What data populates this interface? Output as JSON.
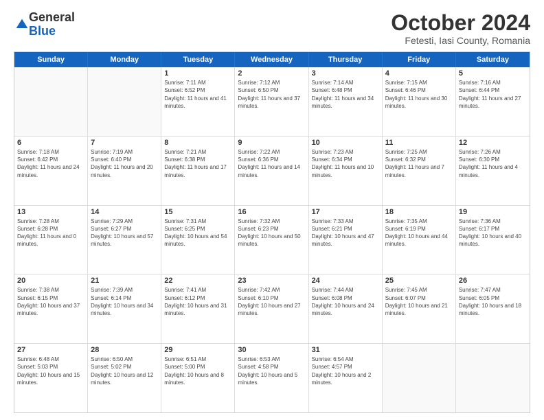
{
  "logo": {
    "general": "General",
    "blue": "Blue"
  },
  "header": {
    "month": "October 2024",
    "location": "Fetesti, Iasi County, Romania"
  },
  "weekdays": [
    "Sunday",
    "Monday",
    "Tuesday",
    "Wednesday",
    "Thursday",
    "Friday",
    "Saturday"
  ],
  "weeks": [
    [
      {
        "day": "",
        "empty": true
      },
      {
        "day": "",
        "empty": true
      },
      {
        "day": "1",
        "sunrise": "Sunrise: 7:11 AM",
        "sunset": "Sunset: 6:52 PM",
        "daylight": "Daylight: 11 hours and 41 minutes."
      },
      {
        "day": "2",
        "sunrise": "Sunrise: 7:12 AM",
        "sunset": "Sunset: 6:50 PM",
        "daylight": "Daylight: 11 hours and 37 minutes."
      },
      {
        "day": "3",
        "sunrise": "Sunrise: 7:14 AM",
        "sunset": "Sunset: 6:48 PM",
        "daylight": "Daylight: 11 hours and 34 minutes."
      },
      {
        "day": "4",
        "sunrise": "Sunrise: 7:15 AM",
        "sunset": "Sunset: 6:46 PM",
        "daylight": "Daylight: 11 hours and 30 minutes."
      },
      {
        "day": "5",
        "sunrise": "Sunrise: 7:16 AM",
        "sunset": "Sunset: 6:44 PM",
        "daylight": "Daylight: 11 hours and 27 minutes."
      }
    ],
    [
      {
        "day": "6",
        "sunrise": "Sunrise: 7:18 AM",
        "sunset": "Sunset: 6:42 PM",
        "daylight": "Daylight: 11 hours and 24 minutes."
      },
      {
        "day": "7",
        "sunrise": "Sunrise: 7:19 AM",
        "sunset": "Sunset: 6:40 PM",
        "daylight": "Daylight: 11 hours and 20 minutes."
      },
      {
        "day": "8",
        "sunrise": "Sunrise: 7:21 AM",
        "sunset": "Sunset: 6:38 PM",
        "daylight": "Daylight: 11 hours and 17 minutes."
      },
      {
        "day": "9",
        "sunrise": "Sunrise: 7:22 AM",
        "sunset": "Sunset: 6:36 PM",
        "daylight": "Daylight: 11 hours and 14 minutes."
      },
      {
        "day": "10",
        "sunrise": "Sunrise: 7:23 AM",
        "sunset": "Sunset: 6:34 PM",
        "daylight": "Daylight: 11 hours and 10 minutes."
      },
      {
        "day": "11",
        "sunrise": "Sunrise: 7:25 AM",
        "sunset": "Sunset: 6:32 PM",
        "daylight": "Daylight: 11 hours and 7 minutes."
      },
      {
        "day": "12",
        "sunrise": "Sunrise: 7:26 AM",
        "sunset": "Sunset: 6:30 PM",
        "daylight": "Daylight: 11 hours and 4 minutes."
      }
    ],
    [
      {
        "day": "13",
        "sunrise": "Sunrise: 7:28 AM",
        "sunset": "Sunset: 6:28 PM",
        "daylight": "Daylight: 11 hours and 0 minutes."
      },
      {
        "day": "14",
        "sunrise": "Sunrise: 7:29 AM",
        "sunset": "Sunset: 6:27 PM",
        "daylight": "Daylight: 10 hours and 57 minutes."
      },
      {
        "day": "15",
        "sunrise": "Sunrise: 7:31 AM",
        "sunset": "Sunset: 6:25 PM",
        "daylight": "Daylight: 10 hours and 54 minutes."
      },
      {
        "day": "16",
        "sunrise": "Sunrise: 7:32 AM",
        "sunset": "Sunset: 6:23 PM",
        "daylight": "Daylight: 10 hours and 50 minutes."
      },
      {
        "day": "17",
        "sunrise": "Sunrise: 7:33 AM",
        "sunset": "Sunset: 6:21 PM",
        "daylight": "Daylight: 10 hours and 47 minutes."
      },
      {
        "day": "18",
        "sunrise": "Sunrise: 7:35 AM",
        "sunset": "Sunset: 6:19 PM",
        "daylight": "Daylight: 10 hours and 44 minutes."
      },
      {
        "day": "19",
        "sunrise": "Sunrise: 7:36 AM",
        "sunset": "Sunset: 6:17 PM",
        "daylight": "Daylight: 10 hours and 40 minutes."
      }
    ],
    [
      {
        "day": "20",
        "sunrise": "Sunrise: 7:38 AM",
        "sunset": "Sunset: 6:15 PM",
        "daylight": "Daylight: 10 hours and 37 minutes."
      },
      {
        "day": "21",
        "sunrise": "Sunrise: 7:39 AM",
        "sunset": "Sunset: 6:14 PM",
        "daylight": "Daylight: 10 hours and 34 minutes."
      },
      {
        "day": "22",
        "sunrise": "Sunrise: 7:41 AM",
        "sunset": "Sunset: 6:12 PM",
        "daylight": "Daylight: 10 hours and 31 minutes."
      },
      {
        "day": "23",
        "sunrise": "Sunrise: 7:42 AM",
        "sunset": "Sunset: 6:10 PM",
        "daylight": "Daylight: 10 hours and 27 minutes."
      },
      {
        "day": "24",
        "sunrise": "Sunrise: 7:44 AM",
        "sunset": "Sunset: 6:08 PM",
        "daylight": "Daylight: 10 hours and 24 minutes."
      },
      {
        "day": "25",
        "sunrise": "Sunrise: 7:45 AM",
        "sunset": "Sunset: 6:07 PM",
        "daylight": "Daylight: 10 hours and 21 minutes."
      },
      {
        "day": "26",
        "sunrise": "Sunrise: 7:47 AM",
        "sunset": "Sunset: 6:05 PM",
        "daylight": "Daylight: 10 hours and 18 minutes."
      }
    ],
    [
      {
        "day": "27",
        "sunrise": "Sunrise: 6:48 AM",
        "sunset": "Sunset: 5:03 PM",
        "daylight": "Daylight: 10 hours and 15 minutes."
      },
      {
        "day": "28",
        "sunrise": "Sunrise: 6:50 AM",
        "sunset": "Sunset: 5:02 PM",
        "daylight": "Daylight: 10 hours and 12 minutes."
      },
      {
        "day": "29",
        "sunrise": "Sunrise: 6:51 AM",
        "sunset": "Sunset: 5:00 PM",
        "daylight": "Daylight: 10 hours and 8 minutes."
      },
      {
        "day": "30",
        "sunrise": "Sunrise: 6:53 AM",
        "sunset": "Sunset: 4:58 PM",
        "daylight": "Daylight: 10 hours and 5 minutes."
      },
      {
        "day": "31",
        "sunrise": "Sunrise: 6:54 AM",
        "sunset": "Sunset: 4:57 PM",
        "daylight": "Daylight: 10 hours and 2 minutes."
      },
      {
        "day": "",
        "empty": true
      },
      {
        "day": "",
        "empty": true
      }
    ]
  ]
}
